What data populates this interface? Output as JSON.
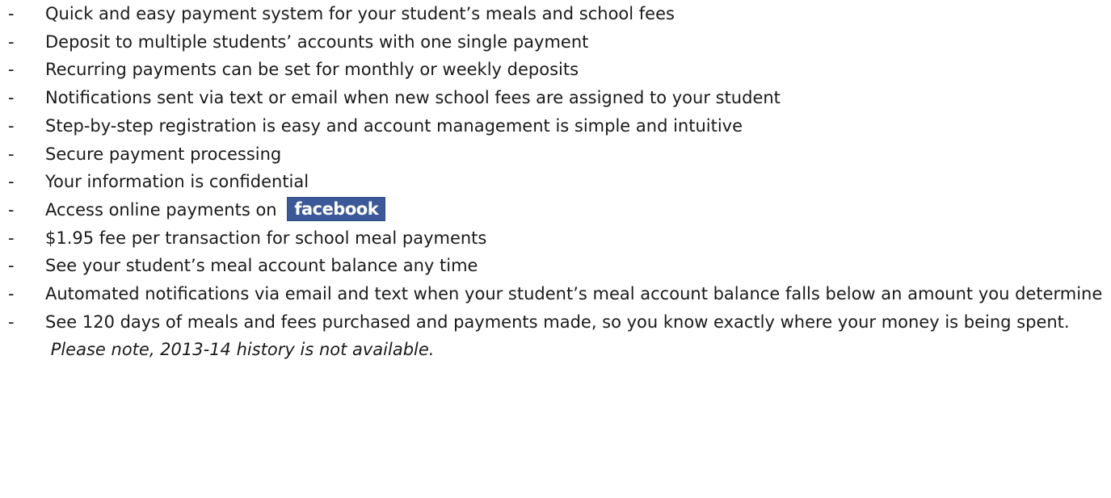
{
  "bullet_marker": "-",
  "items": [
    {
      "text": "Quick and easy payment system for your student’s meals and school fees"
    },
    {
      "text": "Deposit to multiple students’ accounts with one single payment"
    },
    {
      "text": "Recurring payments can be set for monthly or weekly deposits"
    },
    {
      "text": "Notifications sent via text or email when new school fees are assigned to your student"
    },
    {
      "text": "Step-by-step registration is easy and account management is simple and intuitive"
    },
    {
      "text": "Secure payment processing"
    },
    {
      "text": "Your information is confidential"
    },
    {
      "text": "Access online payments on",
      "logo_text": "facebook"
    },
    {
      "text": "$1.95 fee per transaction for school meal payments"
    },
    {
      "text": "See your student’s meal account balance any time"
    },
    {
      "text": "Automated notifications via email and text when your student’s meal account balance falls below an amount you determine"
    },
    {
      "text": "See 120 days of meals and fees purchased and payments made, so you know exactly where your money is being spent.",
      "note": "Please note, 2013-14 history is not available."
    }
  ],
  "colors": {
    "text": "#1a1a1a",
    "facebook_blue": "#3b5998"
  },
  "icons": {
    "facebook": "facebook-logo"
  }
}
